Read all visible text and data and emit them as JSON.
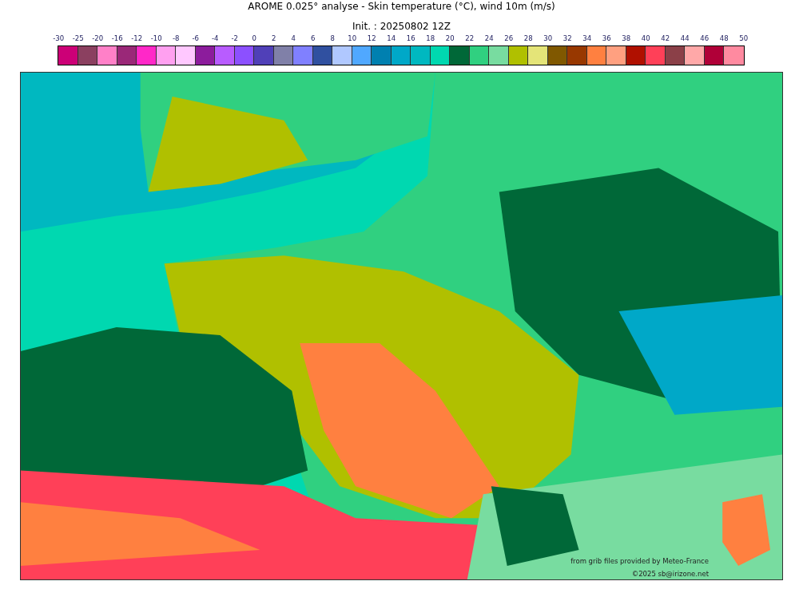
{
  "title": "AROME 0.025° analyse - Skin temperature (°C), wind 10m (m/s)",
  "subtitle": "Init. : 20250802 12Z",
  "colorbar": {
    "ticks": [
      "-30",
      "-25",
      "-20",
      "-16",
      "-12",
      "-10",
      "-8",
      "-6",
      "-4",
      "-2",
      "0",
      "2",
      "4",
      "6",
      "8",
      "10",
      "12",
      "14",
      "16",
      "18",
      "20",
      "22",
      "24",
      "26",
      "28",
      "30",
      "32",
      "34",
      "36",
      "38",
      "40",
      "42",
      "44",
      "46",
      "48",
      "50"
    ],
    "swatches": [
      {
        "color": "#cc0077"
      },
      {
        "color": "#8b4060"
      },
      {
        "color": "#ff80c8"
      },
      {
        "color": "#9a2878"
      },
      {
        "color": "#ff28c8"
      },
      {
        "color": "#ffa0f0"
      },
      {
        "color": "#ffc8ff"
      },
      {
        "color": "#8c1c9c"
      },
      {
        "color": "#b85cff"
      },
      {
        "color": "#8c50ff"
      },
      {
        "color": "#5040b8"
      },
      {
        "color": "#8080a8"
      },
      {
        "color": "#8080ff"
      },
      {
        "color": "#3050a0"
      },
      {
        "color": "#b0c8ff"
      },
      {
        "color": "#50a8ff"
      },
      {
        "color": "#0080b0"
      },
      {
        "color": "#00a8c8"
      },
      {
        "color": "#00b8c0"
      },
      {
        "color": "#00d8b0"
      },
      {
        "color": "#006838"
      },
      {
        "color": "#30d080"
      },
      {
        "color": "#78dca0"
      },
      {
        "color": "#b0c000"
      },
      {
        "color": "#e4e478"
      },
      {
        "color": "#805800"
      },
      {
        "color": "#983800"
      },
      {
        "color": "#ff8040"
      },
      {
        "color": "#ffa080"
      },
      {
        "color": "#b01000"
      },
      {
        "color": "#ff4058"
      },
      {
        "color": "#8b4048"
      },
      {
        "color": "#ffa8a8"
      },
      {
        "color": "#b00038"
      },
      {
        "color": "#ff8aa0"
      }
    ]
  },
  "map": {
    "source": "from grib files provided by Meteo-France",
    "copyright": "©2025 sb@irizone.net"
  }
}
